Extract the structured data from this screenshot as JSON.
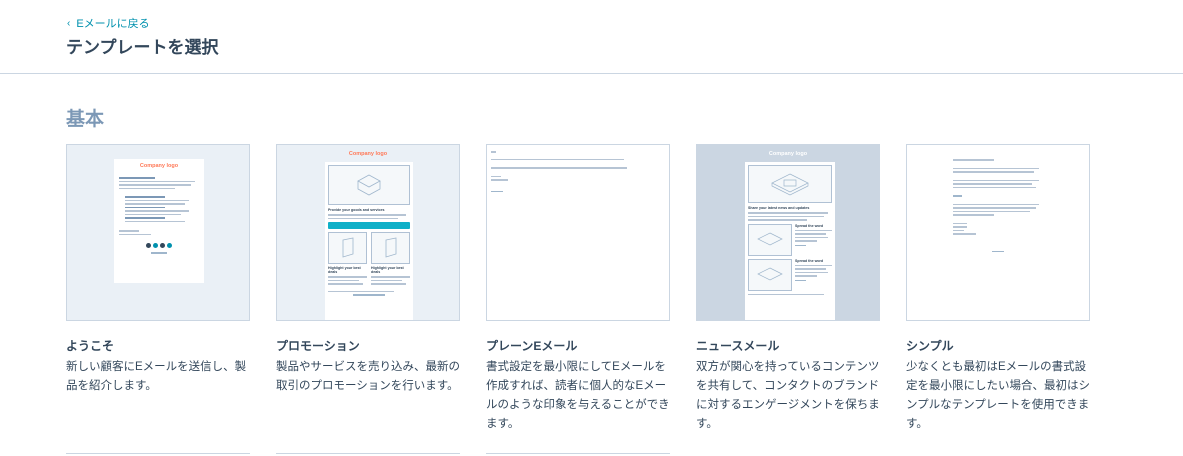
{
  "header": {
    "back_label": "Eメールに戻る",
    "title": "テンプレートを選択"
  },
  "section": {
    "title": "基本"
  },
  "templates": [
    {
      "name": "ようこそ",
      "description": "新しい顧客にEメールを送信し、製品を紹介します。",
      "preview_logo": "Company logo"
    },
    {
      "name": "プロモーション",
      "description": "製品やサービスを売り込み、最新の取引のプロモーションを行います。",
      "preview_logo": "Company logo",
      "preview_heading": "Provide your goods and services",
      "preview_sub1": "Highlight your best deals",
      "preview_sub2": "Highlight your best deals"
    },
    {
      "name": "プレーンEメール",
      "description": "書式設定を最小限にしてEメールを作成すれば、読者に個人的なEメールのような印象を与えることができます。"
    },
    {
      "name": "ニュースメール",
      "description": "双方が関心を持っているコンテンツを共有して、コンタクトのブランドに対するエンゲージメントを保ちます。",
      "preview_logo": "Company logo",
      "preview_heading": "Share your latest news and updates",
      "preview_sub1": "Spread the word",
      "preview_sub2": "Spread the word"
    },
    {
      "name": "シンプル",
      "description": "少なくとも最初はEメールの書式設定を最小限にしたい場合、最初はシンプルなテンプレートを使用できます。"
    }
  ],
  "colors": {
    "accent": "#0091ae",
    "logo": "#ff7a59",
    "text": "#33475b",
    "muted": "#7c98b6",
    "border": "#cbd6e2"
  }
}
